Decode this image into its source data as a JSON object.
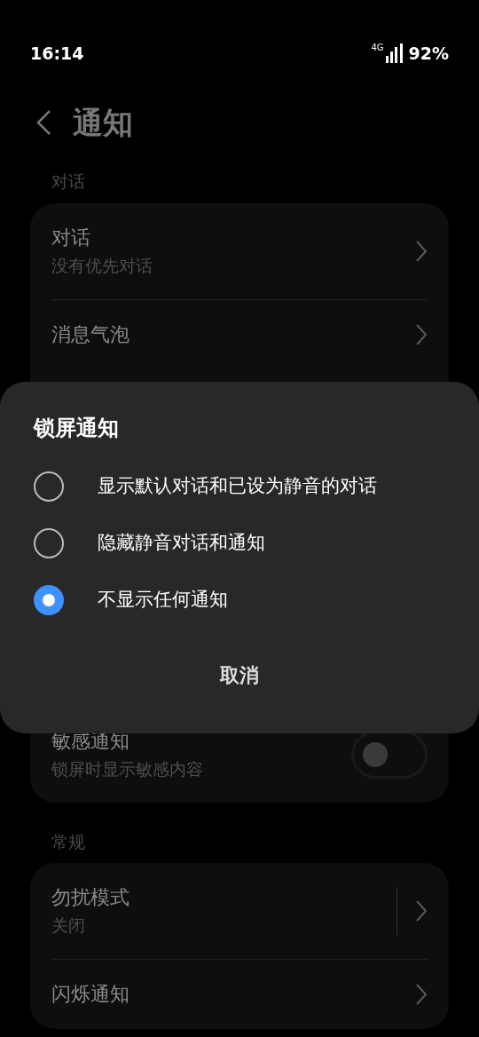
{
  "status_bar": {
    "time": "16:14",
    "network": "4G",
    "battery": "92%"
  },
  "header": {
    "title": "通知"
  },
  "sections": [
    {
      "label": "对话",
      "rows": [
        {
          "kind": "link",
          "title": "对话",
          "subtitle": "没有优先对话"
        },
        {
          "kind": "link",
          "title": "消息气泡"
        },
        {
          "kind": "gap"
        },
        {
          "kind": "toggle",
          "title": "敏感通知",
          "subtitle": "锁屏时显示敏感内容",
          "on": false
        }
      ]
    },
    {
      "label": "常规",
      "rows": [
        {
          "kind": "split",
          "title": "勿扰模式",
          "subtitle": "关闭"
        },
        {
          "kind": "link",
          "title": "闪烁通知"
        }
      ]
    }
  ],
  "dialog": {
    "title": "锁屏通知",
    "options": [
      {
        "label": "显示默认对话和已设为静音的对话",
        "selected": false
      },
      {
        "label": "隐藏静音对话和通知",
        "selected": false
      },
      {
        "label": "不显示任何通知",
        "selected": true
      }
    ],
    "cancel": "取消"
  }
}
